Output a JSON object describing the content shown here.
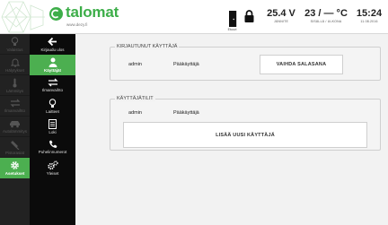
{
  "header": {
    "logo_text": "talomat",
    "logo_url": "www.dezy.fi",
    "door_label": "Etuovi",
    "voltage": {
      "value": "25.4 V",
      "label": "JÄNNITE"
    },
    "temperature": {
      "value": "23 / — °C",
      "label": "SISÄLLÄ / ULKONA"
    },
    "clock": {
      "time": "15:24",
      "date": "11.08.2016"
    }
  },
  "sidebar": {
    "left_items": [
      {
        "label": "Valaistus",
        "icon": "bulb-icon"
      },
      {
        "label": "Hälytykset",
        "icon": "bell-icon"
      },
      {
        "label": "Lämmitys",
        "icon": "thermometer-icon"
      },
      {
        "label": "Ilmanvaihto",
        "icon": "fan-icon"
      },
      {
        "label": "Autolämmitys",
        "icon": "car-icon"
      },
      {
        "label": "Pistorasiat",
        "icon": "plug-icon"
      },
      {
        "label": "Asetukset",
        "icon": "gear-icon",
        "active": true
      }
    ],
    "right_items": [
      {
        "label": "Kirjaudu ulos",
        "icon": "arrow-left-icon"
      },
      {
        "label": "Käyttäjät",
        "icon": "user-icon",
        "active": true
      },
      {
        "label": "Ilmanvaihto",
        "icon": "swap-arrows-icon"
      },
      {
        "label": "Laitteet",
        "icon": "bulb-icon"
      },
      {
        "label": "Loki",
        "icon": "document-icon"
      },
      {
        "label": "Puhelinnumerot",
        "icon": "phone-icon"
      },
      {
        "label": "Yleiset",
        "icon": "gears-icon"
      }
    ]
  },
  "logged_in_section": {
    "title": "KIRJAUTUNUT KÄYTTÄJÄ",
    "username": "admin",
    "role": "Pääkäyttäjä",
    "change_password_button": "VAIHDA SALASANA"
  },
  "users_section": {
    "title": "KÄYTTÄJÄTILIT",
    "users": [
      {
        "username": "admin",
        "role": "Pääkäyttäjä"
      }
    ],
    "add_user_button": "LISÄÄ UUSI KÄYTTÄJÄ"
  },
  "colors": {
    "accent": "#4caf50",
    "logo_green": "#3dae49",
    "sidebar_dark": "#0b0b0b",
    "sidebar_left": "#222222",
    "main_bg": "#f2f2f2"
  }
}
